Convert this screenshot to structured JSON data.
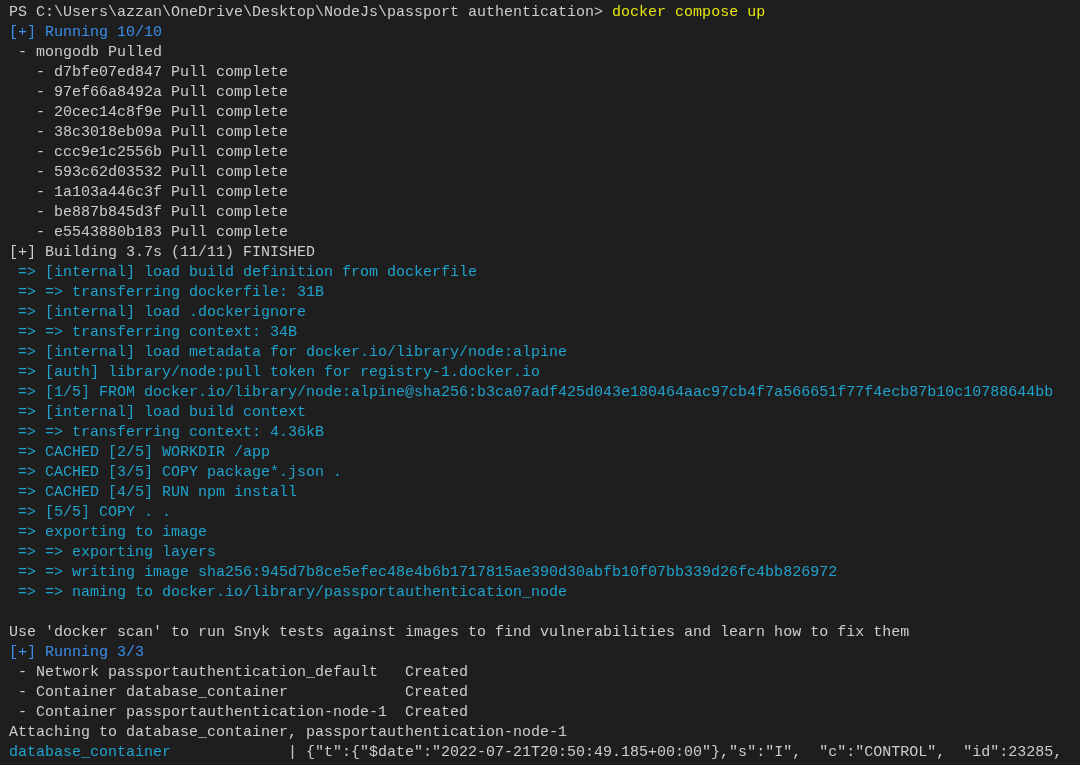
{
  "terminal": {
    "lines": [
      {
        "kind": "text",
        "segments": [
          {
            "kind": "plain",
            "text": "PS C:\\Users\\azzan\\OneDrive\\Desktop\\NodeJs\\passport authentication> "
          },
          {
            "kind": "command",
            "text": "docker compose up"
          }
        ]
      },
      {
        "kind": "text",
        "segments": [
          {
            "kind": "status",
            "text": "[+] Running 10/10"
          }
        ]
      },
      {
        "kind": "text",
        "segments": [
          {
            "kind": "plain",
            "text": " - mongodb Pulled"
          }
        ]
      },
      {
        "kind": "text",
        "segments": [
          {
            "kind": "plain",
            "text": "   - d7bfe07ed847 Pull complete"
          }
        ]
      },
      {
        "kind": "text",
        "segments": [
          {
            "kind": "plain",
            "text": "   - 97ef66a8492a Pull complete"
          }
        ]
      },
      {
        "kind": "text",
        "segments": [
          {
            "kind": "plain",
            "text": "   - 20cec14c8f9e Pull complete"
          }
        ]
      },
      {
        "kind": "text",
        "segments": [
          {
            "kind": "plain",
            "text": "   - 38c3018eb09a Pull complete"
          }
        ]
      },
      {
        "kind": "text",
        "segments": [
          {
            "kind": "plain",
            "text": "   - ccc9e1c2556b Pull complete"
          }
        ]
      },
      {
        "kind": "text",
        "segments": [
          {
            "kind": "plain",
            "text": "   - 593c62d03532 Pull complete"
          }
        ]
      },
      {
        "kind": "text",
        "segments": [
          {
            "kind": "plain",
            "text": "   - 1a103a446c3f Pull complete"
          }
        ]
      },
      {
        "kind": "text",
        "segments": [
          {
            "kind": "plain",
            "text": "   - be887b845d3f Pull complete"
          }
        ]
      },
      {
        "kind": "text",
        "segments": [
          {
            "kind": "plain",
            "text": "   - e5543880b183 Pull complete"
          }
        ]
      },
      {
        "kind": "text",
        "segments": [
          {
            "kind": "plain",
            "text": "[+] Building 3.7s (11/11) FINISHED"
          }
        ]
      },
      {
        "kind": "text",
        "segments": [
          {
            "kind": "step",
            "text": " => [internal] load build definition from dockerfile"
          }
        ]
      },
      {
        "kind": "text",
        "segments": [
          {
            "kind": "step",
            "text": " => => transferring dockerfile: 31B"
          }
        ]
      },
      {
        "kind": "text",
        "segments": [
          {
            "kind": "step",
            "text": " => [internal] load .dockerignore"
          }
        ]
      },
      {
        "kind": "text",
        "segments": [
          {
            "kind": "step",
            "text": " => => transferring context: 34B"
          }
        ]
      },
      {
        "kind": "text",
        "segments": [
          {
            "kind": "step",
            "text": " => [internal] load metadata for docker.io/library/node:alpine"
          }
        ]
      },
      {
        "kind": "text",
        "segments": [
          {
            "kind": "step",
            "text": " => [auth] library/node:pull token for registry-1.docker.io"
          }
        ]
      },
      {
        "kind": "text",
        "segments": [
          {
            "kind": "step",
            "text": " => [1/5] FROM docker.io/library/node:alpine@sha256:b3ca07adf425d043e180464aac97cb4f7a566651f77f4ecb87b10c10788644bb"
          }
        ]
      },
      {
        "kind": "text",
        "segments": [
          {
            "kind": "step",
            "text": " => [internal] load build context"
          }
        ]
      },
      {
        "kind": "text",
        "segments": [
          {
            "kind": "step",
            "text": " => => transferring context: 4.36kB"
          }
        ]
      },
      {
        "kind": "text",
        "segments": [
          {
            "kind": "step",
            "text": " => CACHED [2/5] WORKDIR /app"
          }
        ]
      },
      {
        "kind": "text",
        "segments": [
          {
            "kind": "step",
            "text": " => CACHED [3/5] COPY package*.json ."
          }
        ]
      },
      {
        "kind": "text",
        "segments": [
          {
            "kind": "step",
            "text": " => CACHED [4/5] RUN npm install"
          }
        ]
      },
      {
        "kind": "text",
        "segments": [
          {
            "kind": "step",
            "text": " => [5/5] COPY . ."
          }
        ]
      },
      {
        "kind": "text",
        "segments": [
          {
            "kind": "step",
            "text": " => exporting to image"
          }
        ]
      },
      {
        "kind": "text",
        "segments": [
          {
            "kind": "step",
            "text": " => => exporting layers"
          }
        ]
      },
      {
        "kind": "text",
        "segments": [
          {
            "kind": "step",
            "text": " => => writing image sha256:945d7b8ce5efec48e4b6b1717815ae390d30abfb10f07bb339d26fc4bb826972"
          }
        ]
      },
      {
        "kind": "text",
        "segments": [
          {
            "kind": "step",
            "text": " => => naming to docker.io/library/passportauthentication_node"
          }
        ]
      },
      {
        "kind": "blank"
      },
      {
        "kind": "text",
        "segments": [
          {
            "kind": "plain",
            "text": "Use 'docker scan' to run Snyk tests against images to find vulnerabilities and learn how to fix them"
          }
        ]
      },
      {
        "kind": "text",
        "segments": [
          {
            "kind": "status",
            "text": "[+] Running 3/3"
          }
        ]
      },
      {
        "kind": "text",
        "segments": [
          {
            "kind": "plain",
            "text": " - Network passportauthentication_default   Created"
          }
        ]
      },
      {
        "kind": "text",
        "segments": [
          {
            "kind": "plain",
            "text": " - Container database_container             Created"
          }
        ]
      },
      {
        "kind": "text",
        "segments": [
          {
            "kind": "plain",
            "text": " - Container passportauthentication-node-1  Created"
          }
        ]
      },
      {
        "kind": "text",
        "segments": [
          {
            "kind": "plain",
            "text": "Attaching to database_container, passportauthentication-node-1"
          }
        ]
      },
      {
        "kind": "text",
        "segments": [
          {
            "kind": "service",
            "text": "database_container"
          },
          {
            "kind": "plain",
            "text": "             | {\"t\":{\"$date\":\"2022-07-21T20:50:49.185+00:00\"},\"s\":\"I\",  \"c\":\"CONTROL\",  \"id\":23285,"
          }
        ]
      }
    ]
  }
}
